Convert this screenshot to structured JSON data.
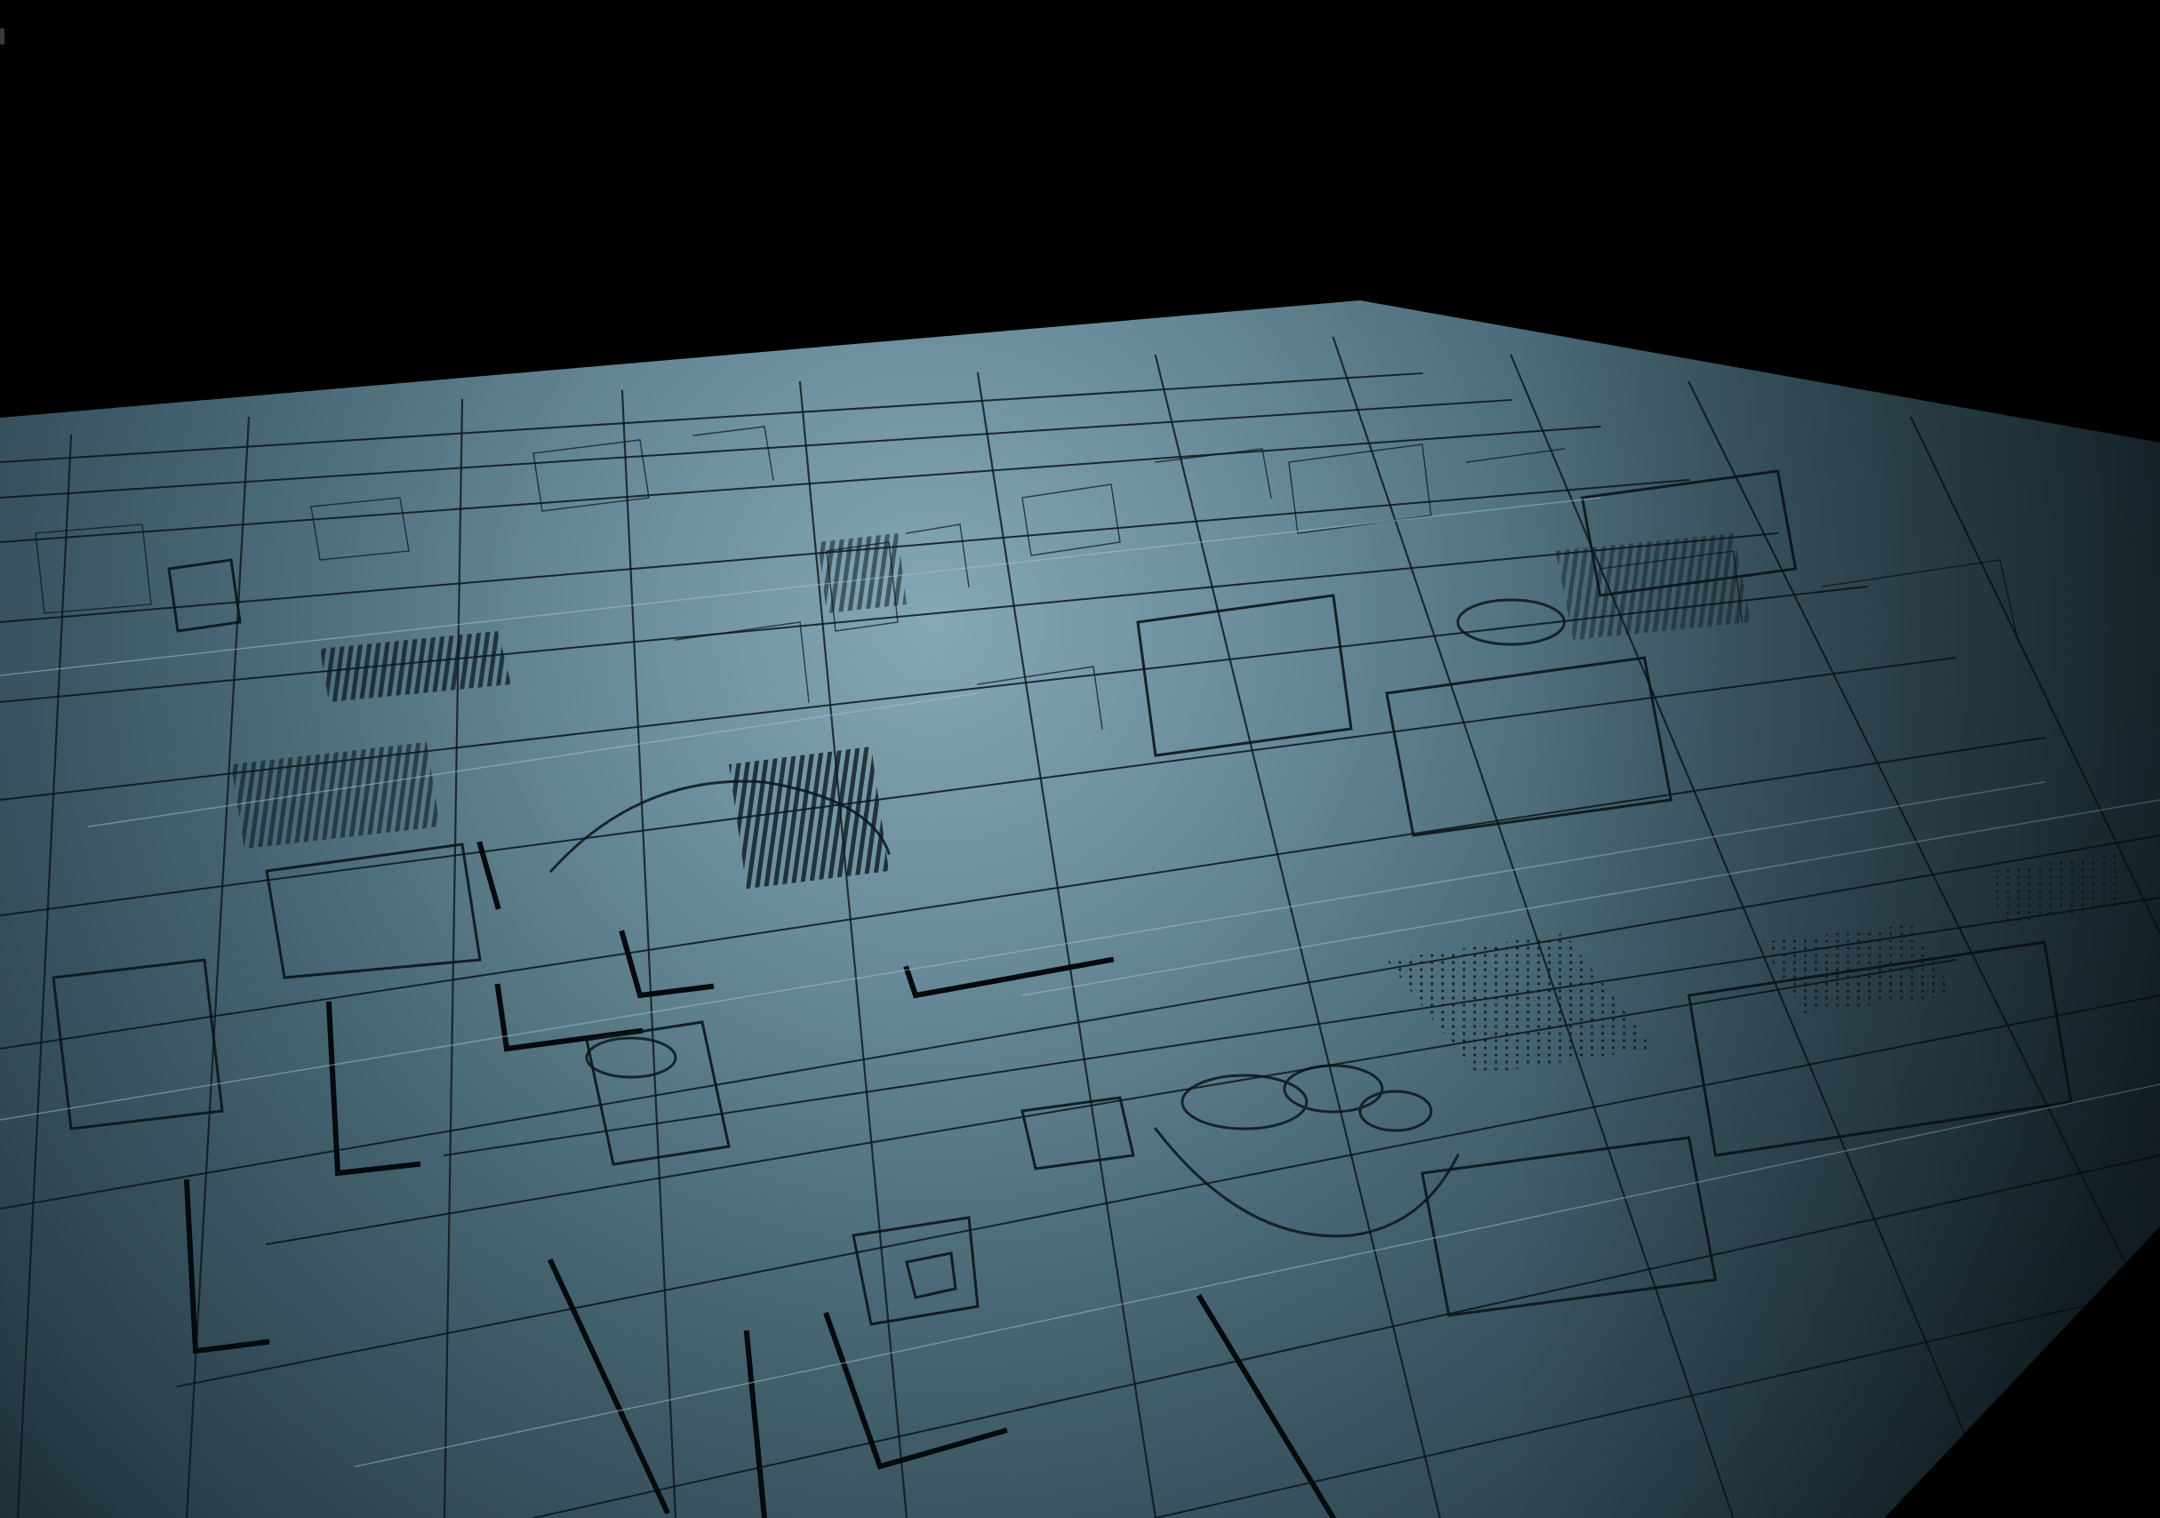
{
  "scene": {
    "description_free": true,
    "colors": {
      "background": "#000000",
      "plate_light": "#7fa3b1",
      "plate_mid": "#4b6a78",
      "plate_dark": "#1c2d36",
      "groove": "#0a1318",
      "highlight": "#a9c6d1"
    }
  }
}
